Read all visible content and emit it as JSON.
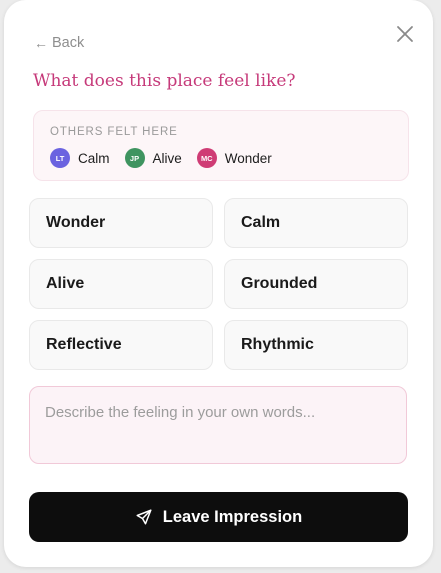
{
  "header": {
    "back_label": "Back",
    "title": "What does this place feel like?"
  },
  "others": {
    "title": "OTHERS FELT HERE",
    "people": [
      {
        "initials": "LT",
        "feeling": "Calm",
        "color": "#6b63e0"
      },
      {
        "initials": "JP",
        "feeling": "Alive",
        "color": "#3f9460"
      },
      {
        "initials": "MC",
        "feeling": "Wonder",
        "color": "#cf3c75"
      }
    ]
  },
  "feelings": [
    "Wonder",
    "Calm",
    "Alive",
    "Grounded",
    "Reflective",
    "Rhythmic"
  ],
  "input": {
    "placeholder": "Describe the feeling in your own words...",
    "value": ""
  },
  "submit": {
    "label": "Leave Impression"
  },
  "colors": {
    "accent": "#c63a7a",
    "button": "#0d0d0d"
  },
  "icons": {
    "close": "close-icon",
    "back": "arrow-left-icon",
    "submit": "send-icon"
  }
}
